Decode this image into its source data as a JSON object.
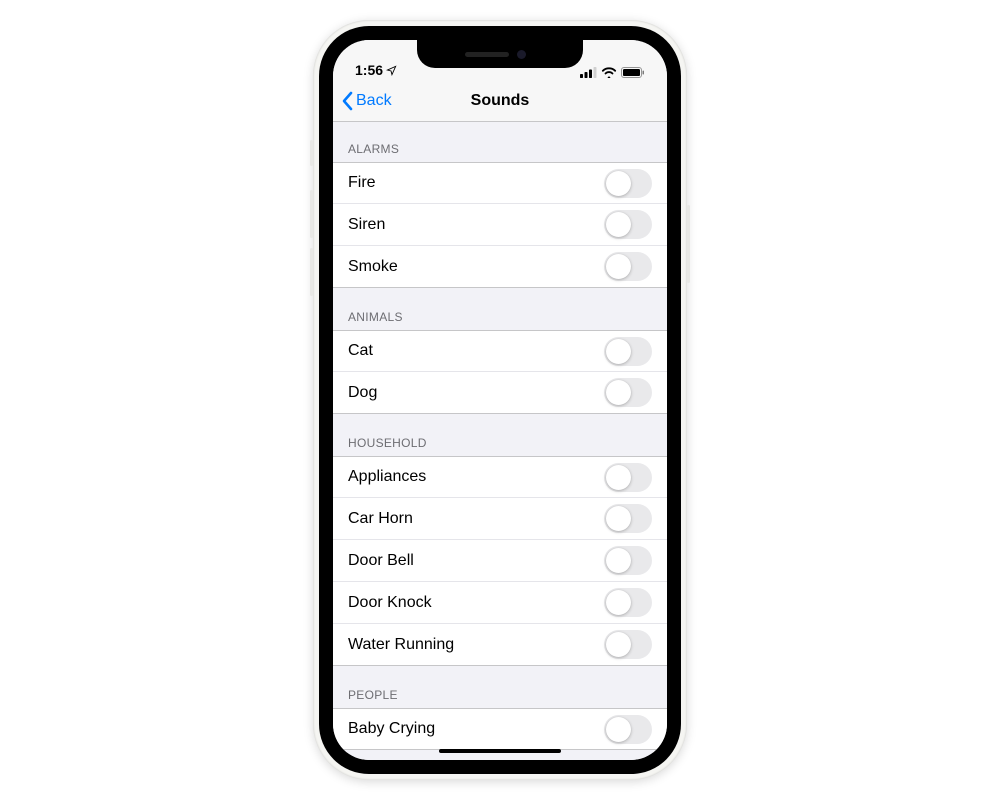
{
  "statusBar": {
    "time": "1:56"
  },
  "nav": {
    "back": "Back",
    "title": "Sounds"
  },
  "sections": [
    {
      "header": "ALARMS",
      "items": [
        {
          "label": "Fire",
          "on": false
        },
        {
          "label": "Siren",
          "on": false
        },
        {
          "label": "Smoke",
          "on": false
        }
      ]
    },
    {
      "header": "ANIMALS",
      "items": [
        {
          "label": "Cat",
          "on": false
        },
        {
          "label": "Dog",
          "on": false
        }
      ]
    },
    {
      "header": "HOUSEHOLD",
      "items": [
        {
          "label": "Appliances",
          "on": false
        },
        {
          "label": "Car Horn",
          "on": false
        },
        {
          "label": "Door Bell",
          "on": false
        },
        {
          "label": "Door Knock",
          "on": false
        },
        {
          "label": "Water Running",
          "on": false
        }
      ]
    },
    {
      "header": "PEOPLE",
      "items": [
        {
          "label": "Baby Crying",
          "on": false
        }
      ]
    }
  ]
}
